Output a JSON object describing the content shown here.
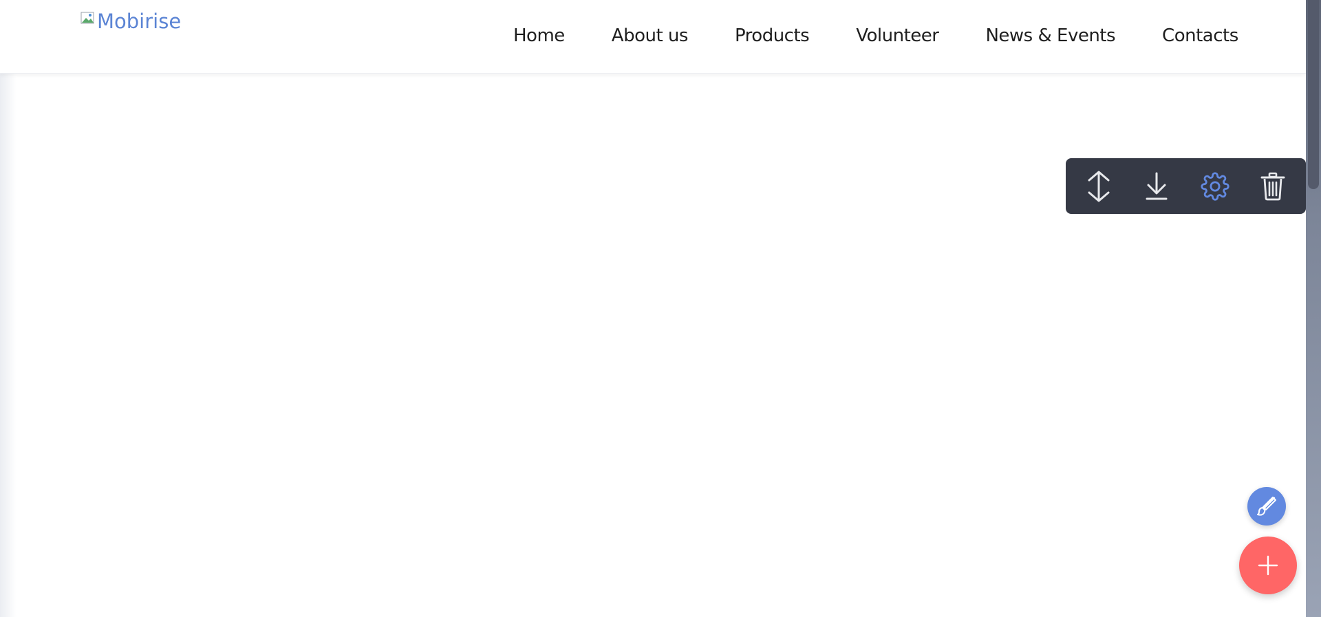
{
  "logo": {
    "alt_text": "Mobirise",
    "icon": "broken-image-icon"
  },
  "nav": {
    "items": [
      {
        "label": "Home"
      },
      {
        "label": "About us"
      },
      {
        "label": "Products"
      },
      {
        "label": "Volunteer"
      },
      {
        "label": "News & Events"
      },
      {
        "label": "Contacts"
      }
    ]
  },
  "block_toolbar": {
    "buttons": [
      {
        "icon": "move-updown-icon"
      },
      {
        "icon": "download-icon"
      },
      {
        "icon": "gear-icon"
      },
      {
        "icon": "trash-icon"
      }
    ]
  },
  "fabs": {
    "edit": {
      "icon": "brush-icon"
    },
    "add": {
      "icon": "plus-icon"
    }
  },
  "colors": {
    "logo_text": "#5b84d4",
    "nav_text": "#1f1f1f",
    "toolbar_bg": "#353945",
    "toolbar_icon": "#e8e9ec",
    "gear_accent": "#6289e0",
    "fab_edit": "#6289e0",
    "fab_add": "#ff6666",
    "scrollbar": "#545a6b"
  }
}
